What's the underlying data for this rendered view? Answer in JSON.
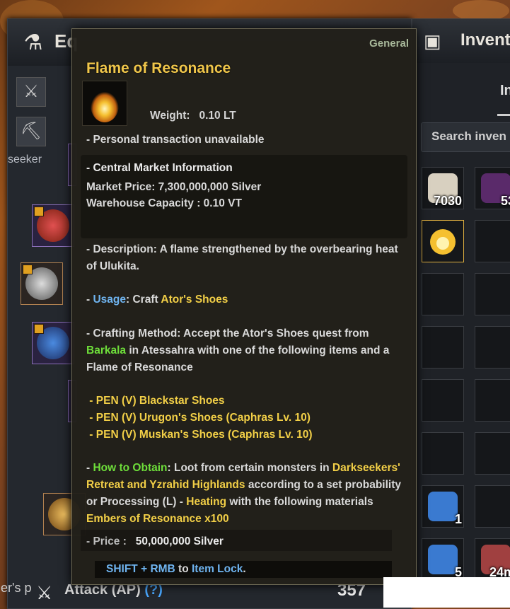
{
  "equipment": {
    "title": "Eq",
    "side_text": "seeker",
    "left_footer_text": "er's p",
    "attack_label": "Attack (AP)",
    "attack_help": "(?)",
    "attack_value": "357"
  },
  "inventory": {
    "title": "Invent",
    "tab_label": "In",
    "search_placeholder": "Search inven",
    "slots": [
      {
        "count": "7030"
      },
      {
        "count": "53"
      },
      {
        "count": ""
      },
      {
        "count": ""
      },
      {
        "count": ""
      },
      {
        "count": ""
      },
      {
        "count": ""
      },
      {
        "count": ""
      },
      {
        "count": ""
      },
      {
        "count": ""
      },
      {
        "count": ""
      },
      {
        "count": ""
      },
      {
        "count": "1"
      },
      {
        "count": ""
      },
      {
        "count": "5"
      },
      {
        "count": "24m"
      }
    ]
  },
  "tooltip": {
    "category": "General",
    "item_name": "Flame of Resonance",
    "weight_label": "Weight:",
    "weight_value": "0.10 LT",
    "transaction": "- Personal transaction unavailable",
    "market_header": "- Central Market Information",
    "market_price": "Market Price: 7,300,000,000 Silver",
    "warehouse_capacity": "Warehouse Capacity : 0.10 VT",
    "description_1": "- Description: A flame strengthened by the overbearing heat",
    "description_2": "of Ulukita.",
    "usage_prefix": "- ",
    "usage_label": "Usage",
    "usage_mid": ": Craft ",
    "usage_item": "Ator's Shoes",
    "craft_1": "- Crafting Method: Accept the Ator's Shoes quest from",
    "craft_npc": "Barkala",
    "craft_2_rest": " in Atessahra with one of the following items and a",
    "craft_3": "Flame of Resonance",
    "options": [
      " - PEN (V) Blackstar Shoes",
      " - PEN (V) Urugon's Shoes (Caphras Lv. 10)",
      " - PEN (V) Muskan's Shoes (Caphras Lv. 10)"
    ],
    "obtain_prefix": "- ",
    "obtain_label": "How to Obtain",
    "obtain_text_1": ": Loot from certain monsters in ",
    "obtain_loc_1": "Darkseekers'",
    "obtain_loc_2": "Retreat and Yzrahid Highlands",
    "obtain_text_2": " according to a set probability",
    "obtain_text_3": "or Processing (L) - ",
    "obtain_heat": "Heating",
    "obtain_text_4": " with the following materials",
    "obtain_material": "Embers of Resonance x100",
    "price_label": "- Price :",
    "price_value": "50,000,000 Silver",
    "lock_key": "SHIFT + RMB",
    "lock_mid": " to ",
    "lock_action": "Item Lock",
    "lock_end": "."
  },
  "colors": {
    "accent": "#f0c64a",
    "green": "#6ede3a",
    "blue": "#6fb4f0"
  }
}
